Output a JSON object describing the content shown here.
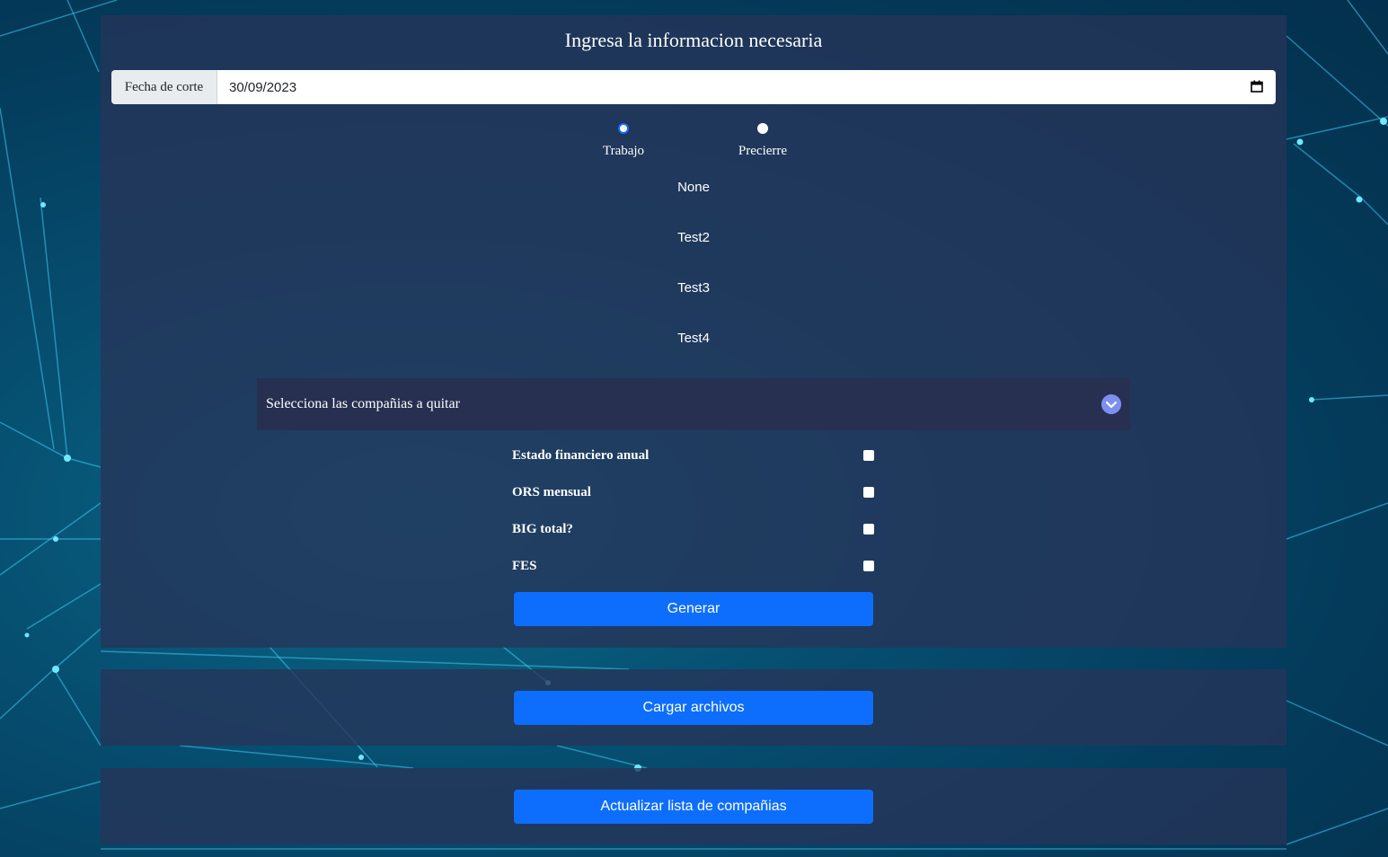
{
  "form": {
    "title": "Ingresa la informacion necesaria",
    "date_label": "Fecha de corte",
    "date_value": "30/09/2023",
    "radios": [
      {
        "label": "Trabajo",
        "checked": true
      },
      {
        "label": "Precierre",
        "checked": false
      }
    ],
    "items": [
      "None",
      "Test2",
      "Test3",
      "Test4"
    ],
    "accordion_label": "Selecciona las compañias a quitar",
    "checkboxes": [
      {
        "label": "Estado financiero anual",
        "checked": false
      },
      {
        "label": "ORS mensual",
        "checked": false
      },
      {
        "label": "BIG total?",
        "checked": false
      },
      {
        "label": "FES",
        "checked": false
      }
    ],
    "generate_label": "Generar"
  },
  "upload": {
    "button_label": "Cargar archivos"
  },
  "update": {
    "button_label": "Actualizar lista de compañias"
  },
  "colors": {
    "accent": "#0d6efd",
    "panel": "#263458",
    "accordion": "#273050",
    "chevron": "#7d8ff0"
  },
  "icons": {
    "date": "calendar-icon",
    "accordion": "chevron-down-icon"
  }
}
